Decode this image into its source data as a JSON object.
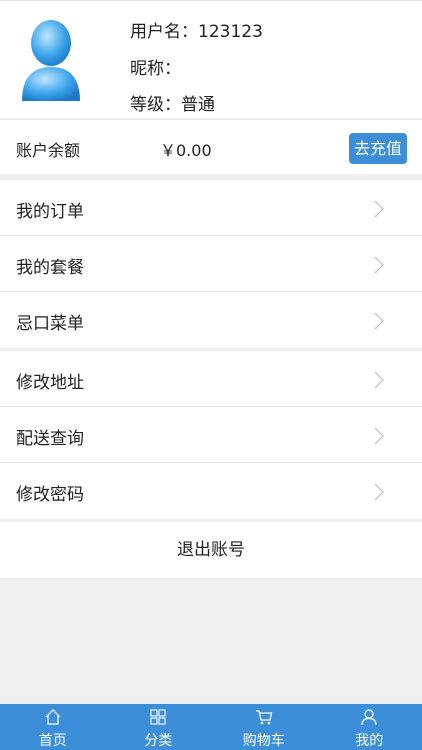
{
  "profile": {
    "username_line": "用户名：123123",
    "nickname_line": "昵称：",
    "level_line": "等级：普通",
    "avatar_icon": "user-avatar-icon"
  },
  "balance": {
    "label": "账户余额",
    "amount": "￥0.00",
    "recharge_label": "去充值"
  },
  "menu_group_1": [
    {
      "label": "我的订单",
      "icon": "chevron-right-icon"
    },
    {
      "label": "我的套餐",
      "icon": "chevron-right-icon"
    },
    {
      "label": "忌口菜单",
      "icon": "chevron-right-icon"
    }
  ],
  "menu_group_2": [
    {
      "label": "修改地址",
      "icon": "chevron-right-icon"
    },
    {
      "label": "配送查询",
      "icon": "chevron-right-icon"
    },
    {
      "label": "修改密码",
      "icon": "chevron-right-icon"
    }
  ],
  "logout_label": "退出账号",
  "tabs": [
    {
      "label": "首页",
      "icon": "home-icon"
    },
    {
      "label": "分类",
      "icon": "grid-icon"
    },
    {
      "label": "购物车",
      "icon": "cart-icon"
    },
    {
      "label": "我的",
      "icon": "user-icon"
    }
  ],
  "colors": {
    "accent": "#3b8ed7",
    "background": "#efefef",
    "surface": "#ffffff"
  }
}
